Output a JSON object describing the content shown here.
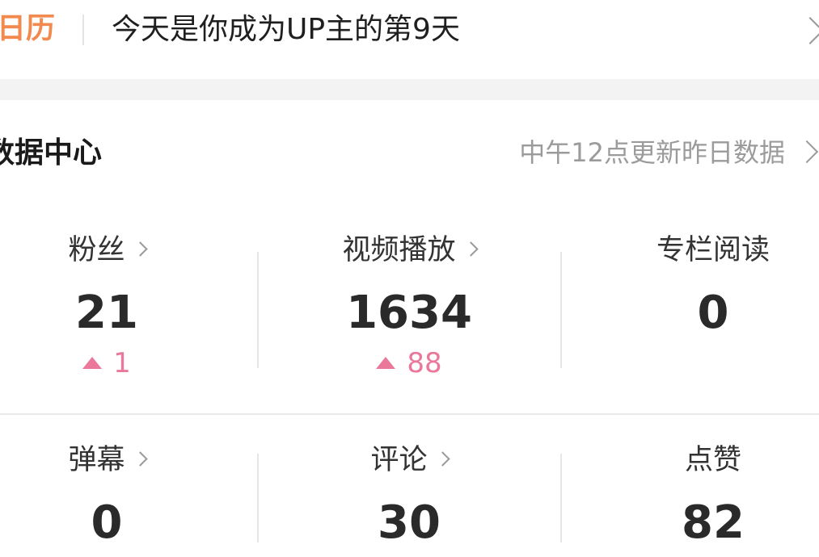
{
  "calendar": {
    "logo_text": "日历",
    "message": "今天是你成为UP主的第9天"
  },
  "data_center": {
    "title": "数据中心",
    "update_note": "中午12点更新昨日数据"
  },
  "stats": [
    {
      "label": "粉丝",
      "value": "21",
      "delta": "1",
      "has_arrow": true,
      "has_delta": true
    },
    {
      "label": "视频播放",
      "value": "1634",
      "delta": "88",
      "has_arrow": true,
      "has_delta": true
    },
    {
      "label": "专栏阅读",
      "value": "0",
      "delta": "",
      "has_arrow": false,
      "has_delta": false
    },
    {
      "label": "弹幕",
      "value": "0",
      "delta": "",
      "has_arrow": true,
      "has_delta": false
    },
    {
      "label": "评论",
      "value": "30",
      "delta": "",
      "has_arrow": true,
      "has_delta": false
    },
    {
      "label": "点赞",
      "value": "82",
      "delta": "",
      "has_arrow": false,
      "has_delta": false
    }
  ],
  "colors": {
    "logo": "#f2894f",
    "delta_up": "#e9789a",
    "muted_text": "#9b9b9b"
  },
  "icons": {
    "row_chevron": "chevron-right-icon",
    "delta_up": "triangle-up-icon"
  }
}
